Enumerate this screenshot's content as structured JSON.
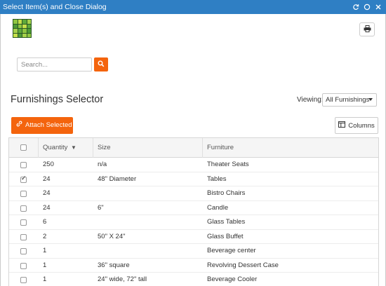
{
  "window": {
    "title": "Select Item(s) and Close Dialog"
  },
  "search": {
    "placeholder": "Search..."
  },
  "section": {
    "title": "Furnishings Selector",
    "viewing_label": "Viewing:",
    "viewing_value": "All Furnishings"
  },
  "toolbar": {
    "attach_label": "Attach Selected",
    "columns_label": "Columns"
  },
  "colors": {
    "titlebar": "#2f7fc4",
    "accent": "#f4640d"
  },
  "table": {
    "headers": {
      "quantity": "Quantity",
      "size": "Size",
      "furniture": "Furniture"
    },
    "sort_indicator": "▼",
    "rows": [
      {
        "checked": false,
        "quantity": "250",
        "size": "n/a",
        "furniture": "Theater Seats"
      },
      {
        "checked": true,
        "quantity": "24",
        "size": "48\" Diameter",
        "furniture": "Tables"
      },
      {
        "checked": false,
        "quantity": "24",
        "size": "",
        "furniture": "Bistro Chairs"
      },
      {
        "checked": false,
        "quantity": "24",
        "size": "6\"",
        "furniture": "Candle"
      },
      {
        "checked": false,
        "quantity": "6",
        "size": "",
        "furniture": "Glass Tables"
      },
      {
        "checked": false,
        "quantity": "2",
        "size": "50\" X 24\"",
        "furniture": "Glass Buffet"
      },
      {
        "checked": false,
        "quantity": "1",
        "size": "",
        "furniture": "Beverage center"
      },
      {
        "checked": false,
        "quantity": "1",
        "size": "36\" square",
        "furniture": "Revolving Dessert Case"
      },
      {
        "checked": false,
        "quantity": "1",
        "size": "24\" wide, 72\" tall",
        "furniture": "Beverage Cooler"
      }
    ]
  },
  "icons": {
    "titlebar": [
      "refresh-icon",
      "restore-icon",
      "close-icon"
    ],
    "print": "print-icon",
    "search": "search-icon",
    "attach": "link-icon",
    "columns": "columns-icon"
  }
}
